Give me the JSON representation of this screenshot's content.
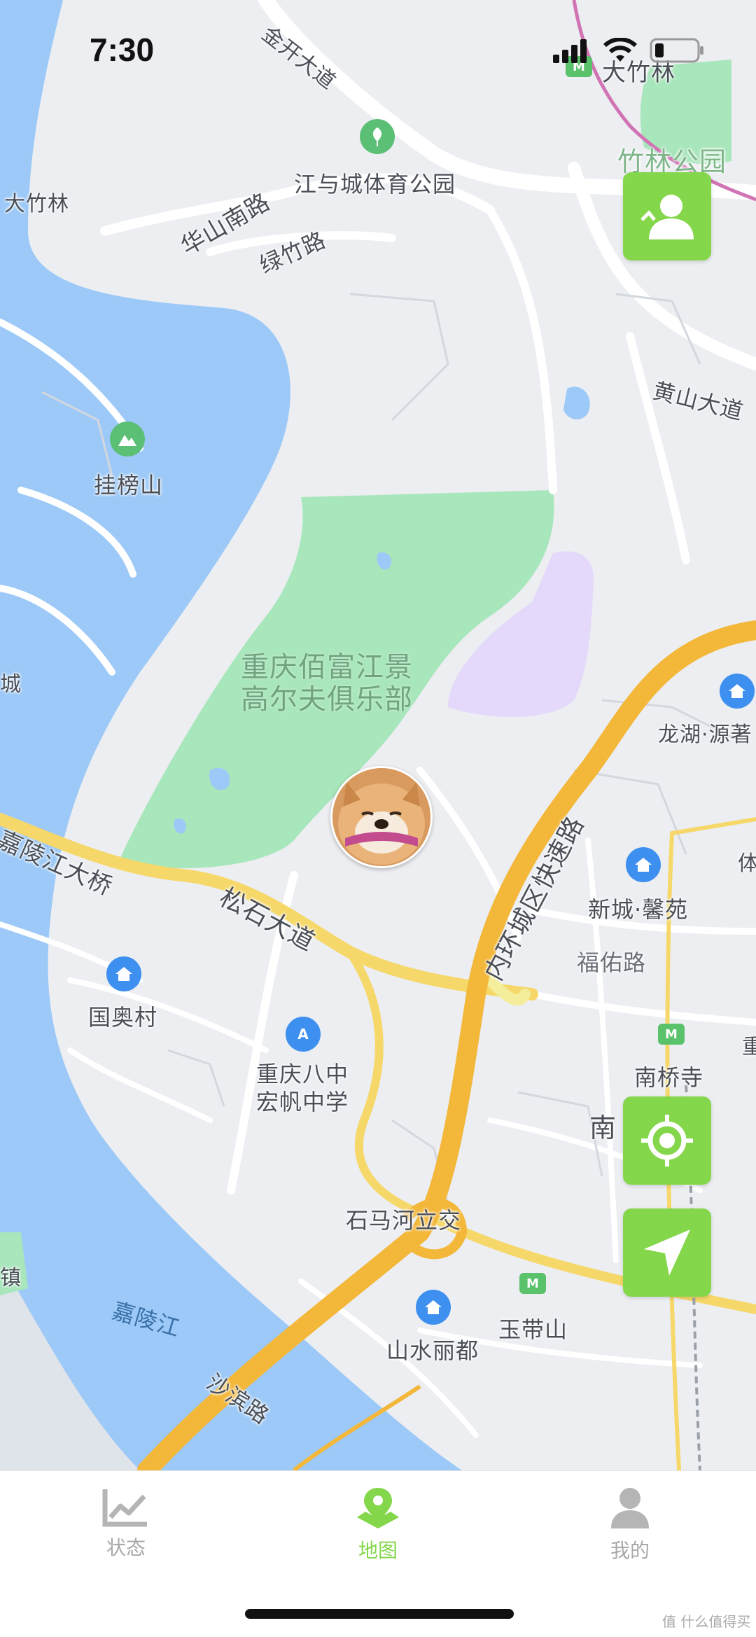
{
  "status_bar": {
    "time": "7:30"
  },
  "map": {
    "labels": {
      "jinkai": "金开大道",
      "dazhulin_top": "大竹林",
      "zhulin_park": "竹林公园",
      "dazhulin_left": "大竹林",
      "huashan": "华山南路",
      "jiangyucheng": "江与城体育公园",
      "lvzhu": "绿竹路",
      "huangshan": "黄山大道",
      "guabangshan": "挂榜山",
      "golf": "重庆佰富江景\n高尔夫俱乐部",
      "cheng": "城",
      "longhu": "龙湖·源著",
      "jialing_bridge": "嘉陵江大桥",
      "songshi": "松石大道",
      "neihuan": "内环城区快速路",
      "xincheng": "新城·馨苑",
      "ti": "体",
      "fuyou": "福佑路",
      "guoao": "国奥村",
      "bazhong": "重庆八中\n宏帆中学",
      "nanqiaosi": "南桥寺",
      "chong": "重",
      "nan": "南",
      "shimahe": "石马河立交",
      "jialingjiang": "嘉陵江",
      "yudaishan": "玉带山",
      "shanshui": "山水丽都",
      "shabin": "沙滨路",
      "zhen": "镇"
    }
  },
  "tabs": [
    {
      "label": "状态",
      "icon": "chart-icon",
      "active": false
    },
    {
      "label": "地图",
      "icon": "map-pin-icon",
      "active": true
    },
    {
      "label": "我的",
      "icon": "person-icon",
      "active": false
    }
  ],
  "watermark": "值 什么值得买",
  "colors": {
    "accent": "#84d64a",
    "water": "#9cc9f7",
    "park": "#a8e6bb",
    "highway": "#f3b73a"
  }
}
